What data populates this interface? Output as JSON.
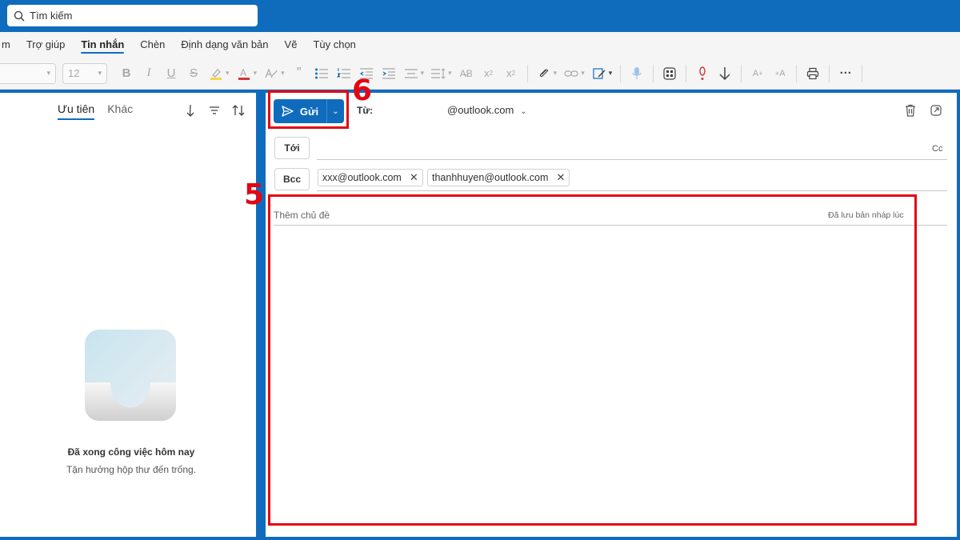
{
  "search": {
    "placeholder": "Tìm kiếm"
  },
  "menu": {
    "items": [
      "m",
      "Trợ giúp",
      "Tin nhắn",
      "Chèn",
      "Định dạng văn bản",
      "Vẽ",
      "Tùy chọn"
    ],
    "active": "Tin nhắn"
  },
  "ribbon": {
    "font_size": "12",
    "icons": [
      "bold-icon",
      "italic-icon",
      "underline-icon",
      "strikethrough-icon",
      "highlight-icon",
      "font-color-icon",
      "styles-icon",
      "quote-icon",
      "bullets-icon",
      "numbering-icon",
      "outdent-icon",
      "indent-icon",
      "align-icon",
      "line-spacing-icon",
      "clear-format-icon",
      "subscript-icon",
      "superscript-icon",
      "attach-icon",
      "link-icon",
      "signature-icon",
      "dictate-icon",
      "apps-icon",
      "importance-high-icon",
      "importance-low-icon",
      "text-predict-icon",
      "spell-icon",
      "print-icon",
      "more-icon"
    ]
  },
  "folder_pane": {
    "tabs": [
      "Ưu tiên",
      "Khác"
    ],
    "empty_title": "Đã xong công việc hôm nay",
    "empty_subtitle": "Tận hưởng hộp thư đến trống."
  },
  "compose": {
    "send_label": "Gửi",
    "from_label": "Từ:",
    "from_value": "@outlook.com",
    "to_button": "Tới",
    "bcc_button": "Bcc",
    "cc_label": "Cc",
    "bcc_recipients": [
      "xxx@outlook.com",
      "thanhhuyen@outlook.com"
    ],
    "subject_placeholder": "Thêm chủ đề",
    "draft_status": "Đã lưu bản nháp lúc"
  },
  "annotations": {
    "step_body": "5",
    "step_send": "6"
  },
  "colors": {
    "brand": "#0f6cbd",
    "annotation": "#e30613"
  }
}
